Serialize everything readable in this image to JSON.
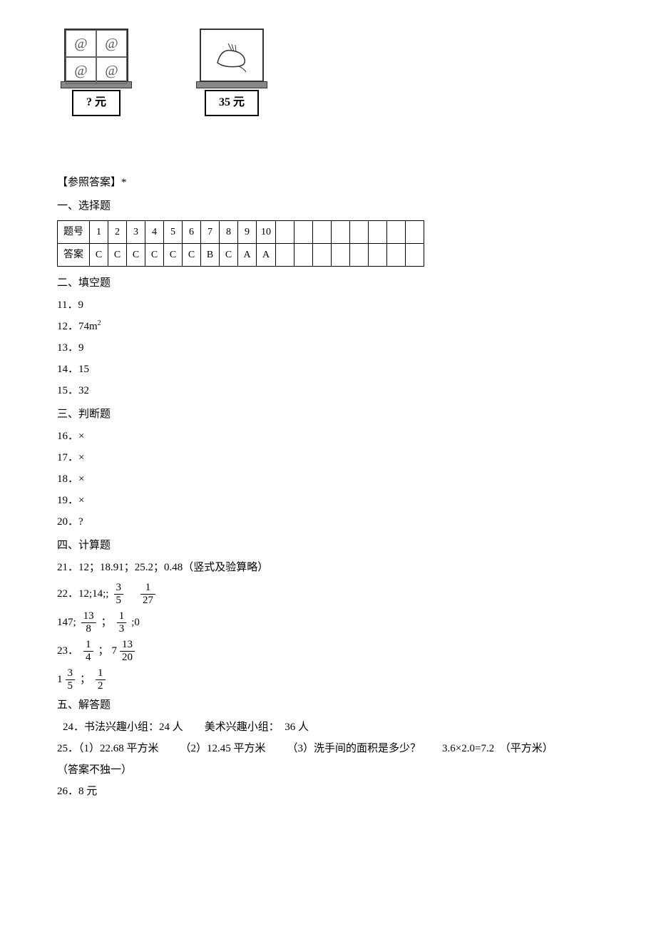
{
  "images": {
    "box1_label": "? 元",
    "box2_label": "35 元"
  },
  "reference_header": "【参照答案】*",
  "sections": {
    "s1_title": "一、选择题",
    "s2_title": "二、填空题",
    "s3_title": "三、判断题",
    "s4_title": "四、计算题",
    "s5_title": "五、解答题"
  },
  "choice_table": {
    "row_label": "题号",
    "ans_label": "答案",
    "nums": [
      "1",
      "2",
      "3",
      "4",
      "5",
      "6",
      "7",
      "8",
      "9",
      "10"
    ],
    "answers": [
      "C",
      "C",
      "C",
      "C",
      "C",
      "C",
      "B",
      "C",
      "A",
      "A"
    ],
    "blanks": [
      "",
      "",
      "",
      "",
      "",
      "",
      "",
      ""
    ]
  },
  "fill": {
    "q11": "11．9",
    "q12_pre": "12．74m",
    "q12_sup": "2",
    "q13": "13．9",
    "q14": "14．15",
    "q15": "15．32"
  },
  "judge": {
    "q16": "16．×",
    "q17": "17．×",
    "q18": "18．×",
    "q19": "19．×",
    "q20": "20．?"
  },
  "calc": {
    "q21": "21．12；18.91；25.2；0.48（竖式及验算略）",
    "q22_pre": "22．12;14;;",
    "q22_f1_n": "3",
    "q22_f1_d": "5",
    "q22_f2_n": "1",
    "q22_f2_d": "27",
    "q22b_pre": "147;",
    "q22b_f1_n": "13",
    "q22b_f1_d": "8",
    "q22b_sep": "；",
    "q22b_f2_n": "1",
    "q22b_f2_d": "3",
    "q22b_suf": ";0",
    "q23_pre": "23．",
    "q23_f1_n": "1",
    "q23_f1_d": "4",
    "q23_sep": "；",
    "q23_m_whole": "7",
    "q23_m_n": "13",
    "q23_m_d": "20",
    "q23b_m_whole": "1",
    "q23b_m_n": "3",
    "q23b_m_d": "5",
    "q23b_sep": "；",
    "q23b_f_n": "1",
    "q23b_f_d": "2"
  },
  "solve": {
    "q24": "24．书法兴趣小组：24 人　　美术兴趣小组：　36 人",
    "q25_p1": "25．（1）22.68 平方米",
    "q25_p2": "（2）12.45 平方米",
    "q25_p3": "（3）洗手间的面积是多少？",
    "q25_p4": "3.6×2.0=7.2　（平方米）",
    "q25_note": "（答案不独一）",
    "q26": "26．8 元"
  }
}
